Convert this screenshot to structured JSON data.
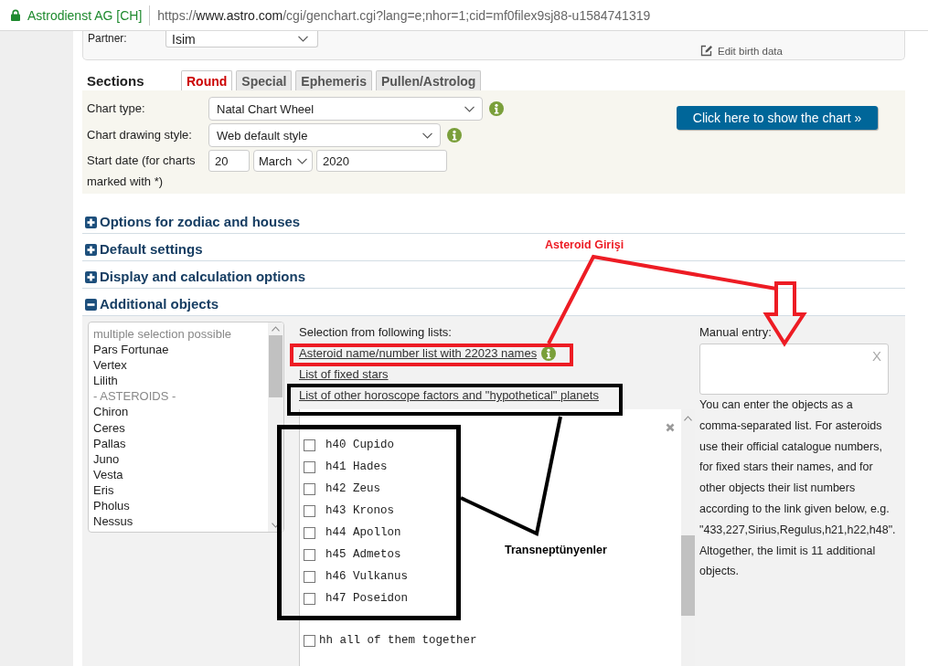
{
  "browser": {
    "site_identity": "Astrodienst AG [CH]",
    "url": {
      "scheme": "https://",
      "host": "www.astro.com",
      "path": "/cgi/genchart.cgi?lang=e;nhor=1;cid=mf0filex9sj88-u1584741319"
    }
  },
  "partner": {
    "label": "Partner:",
    "value": "Isim",
    "edit_link": "Edit birth data"
  },
  "sections": {
    "title": "Sections",
    "tabs": [
      {
        "label": "Round",
        "selected": true
      },
      {
        "label": "Special",
        "selected": false
      },
      {
        "label": "Ephemeris",
        "selected": false
      },
      {
        "label": "Pullen/Astrolog",
        "selected": false
      }
    ]
  },
  "chart_form": {
    "fields": [
      {
        "kind": "select",
        "label": "Chart type:",
        "value": "Natal Chart Wheel",
        "info": true
      },
      {
        "kind": "select",
        "label": "Chart drawing style:",
        "value": "Web default style",
        "info": true
      },
      {
        "kind": "date",
        "label": "Start date (for charts marked with *)",
        "day": "20",
        "month": "March",
        "year": "2020"
      }
    ],
    "show_chart_button": "Click here to show the chart »"
  },
  "accordion": [
    {
      "title": "Options for zodiac and houses",
      "expanded": false
    },
    {
      "title": "Default settings",
      "expanded": false
    },
    {
      "title": "Display and calculation options",
      "expanded": false
    },
    {
      "title": "Additional objects",
      "expanded": true,
      "content": {
        "listbox": [
          {
            "kind": "header",
            "text": "multiple selection possible"
          },
          {
            "kind": "option",
            "text": "Pars Fortunae"
          },
          {
            "kind": "option",
            "text": "Vertex"
          },
          {
            "kind": "option",
            "text": "Lilith"
          },
          {
            "kind": "header",
            "text": "- ASTEROIDS -"
          },
          {
            "kind": "option",
            "text": "Chiron"
          },
          {
            "kind": "option",
            "text": "Ceres"
          },
          {
            "kind": "option",
            "text": "Pallas"
          },
          {
            "kind": "option",
            "text": "Juno"
          },
          {
            "kind": "option",
            "text": "Vesta"
          },
          {
            "kind": "option",
            "text": "Eris"
          },
          {
            "kind": "option",
            "text": "Pholus"
          },
          {
            "kind": "option",
            "text": "Nessus"
          }
        ],
        "lists_heading": "Selection from following lists:",
        "links": [
          {
            "text": "Asteroid name/number list with 22023 names",
            "info": true
          },
          {
            "text": "List of fixed stars",
            "info": false
          },
          {
            "text": "List of other horoscope factors and \"hypothetical\" planets",
            "info": false
          }
        ],
        "popup": {
          "items": [
            {
              "label": "h40 Cupido",
              "checked": false
            },
            {
              "label": "h41 Hades",
              "checked": false
            },
            {
              "label": "h42 Zeus",
              "checked": false
            },
            {
              "label": "h43 Kronos",
              "checked": false
            },
            {
              "label": "h44 Apollon",
              "checked": false
            },
            {
              "label": "h45 Admetos",
              "checked": false
            },
            {
              "label": "h46 Vulkanus",
              "checked": false
            },
            {
              "label": "h47 Poseidon",
              "checked": false
            }
          ],
          "all_option": {
            "label": "hh all of them together",
            "checked": false
          }
        },
        "manual_entry": {
          "label": "Manual entry:",
          "clear_button": "X",
          "help": "You can enter the objects as a comma-separated list. For asteroids use their official catalogue numbers, for fixed stars their names, and for other objects their list numbers according to the link given below, e.g. \"433,227,Sirius,Regulus,h21,h22,h48\". Altogether, the limit is 11 additional objects."
        }
      }
    }
  ],
  "annotations": [
    {
      "text": "Asteroid Girişi",
      "color": "#ed1c24"
    },
    {
      "text": "Transneptünyenler",
      "color": "#000000"
    }
  ]
}
